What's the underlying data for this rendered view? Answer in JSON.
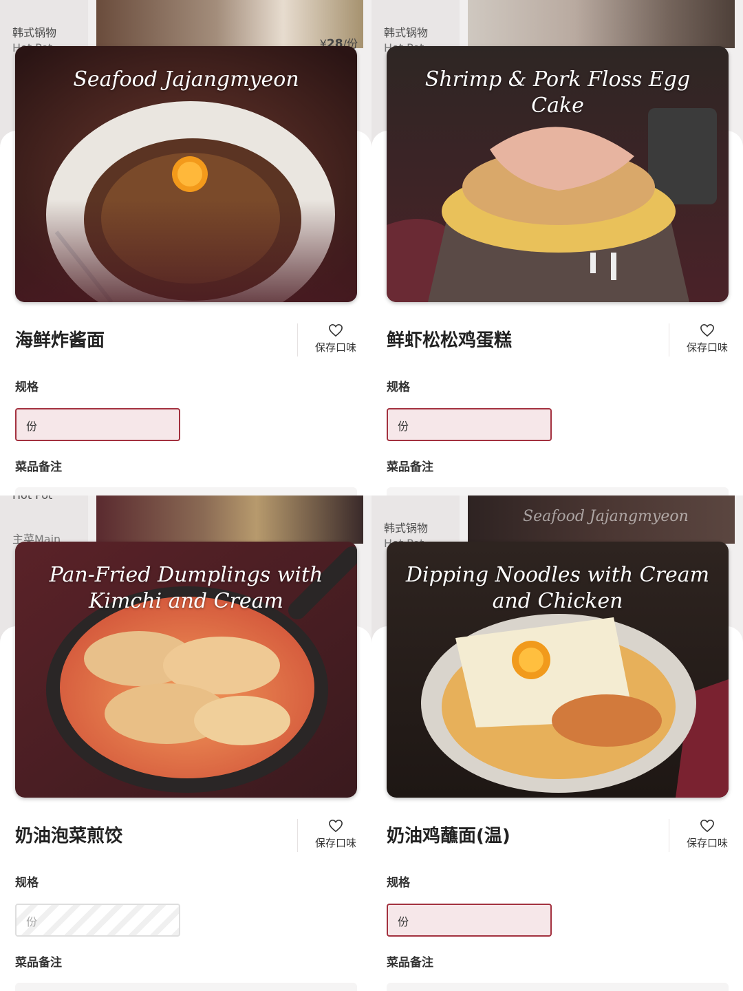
{
  "panels": [
    {
      "bg": {
        "cat1": "韩式锅物",
        "cat2": "Hot Pot",
        "price_symbol": "¥",
        "price_value": "28",
        "price_unit": "/份"
      },
      "image_title": "Seafood Jajangmyeon",
      "dish_name": "海鲜炸酱面",
      "favorite_label": "保存口味",
      "spec_label": "规格",
      "spec_option": "份",
      "note_label": "菜品备注"
    },
    {
      "bg": {
        "cat1": "韩式锅物",
        "cat2": "Hot Pot"
      },
      "image_title": "Shrimp & Pork Floss Egg Cake",
      "dish_name": "鲜虾松松鸡蛋糕",
      "favorite_label": "保存口味",
      "spec_label": "规格",
      "spec_option": "份",
      "note_label": "菜品备注"
    },
    {
      "bg": {
        "cat1": "Hot Pot",
        "cat2": "主菜Main"
      },
      "image_title": "Pan-Fried Dumplings with Kimchi and Cream",
      "dish_name": "奶油泡菜煎饺",
      "favorite_label": "保存口味",
      "spec_label": "规格",
      "spec_option": "份",
      "note_label": "菜品备注"
    },
    {
      "bg": {
        "cat1": "韩式锅物",
        "cat2": "Hot Pot",
        "ghost_title": "Seafood Jajangmyeon"
      },
      "image_title": "Dipping Noodles with Cream and Chicken",
      "dish_name": "奶油鸡蘸面(温)",
      "favorite_label": "保存口味",
      "spec_label": "规格",
      "spec_option": "份",
      "note_label": "菜品备注"
    }
  ],
  "colors": {
    "accent": "#a3313f",
    "accent_bg": "#f6e7e9"
  }
}
